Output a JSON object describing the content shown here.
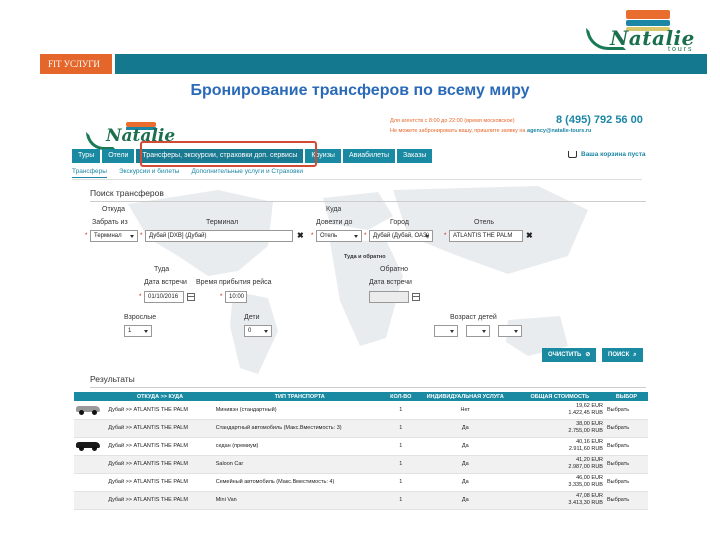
{
  "slide": {
    "fit_label": "FIT УСЛУГИ",
    "title": "Бронирование трансферов по всему миру",
    "logo_text": "Natalie",
    "logo_sub": "tours"
  },
  "site": {
    "logo_text": "Natalie",
    "hours_note": "Для агентств с 8:00 до 22:00 (время московское)",
    "phone": "8 (495) 792 56 00",
    "agency_note": "Не можете забронировать вашу, пришлите заявку на",
    "email": "agency@natalie-tours.ru",
    "cart": "Ваша корзина пуста"
  },
  "nav": {
    "items": [
      "Туры",
      "Отели",
      "Трансферы, экскурсии, страховки доп. сервисы",
      "Круизы",
      "Авиабилеты",
      "Заказы"
    ]
  },
  "subnav": {
    "items": [
      "Трансферы",
      "Экскурсии и билеты",
      "Дополнительные услуги и Страховки"
    ]
  },
  "search": {
    "title": "Поиск трансферов",
    "from_label": "Откуда",
    "to_label": "Куда",
    "pickup_label": "Забрать из",
    "pickup_value": "Терминал",
    "terminal_label": "Терминал",
    "terminal_value": "Дубай [DXB] (Дубай)",
    "dropoff_label": "Довезти до",
    "dropoff_value": "Отель",
    "city_label": "Город",
    "city_value": "Дубай (Дубай, ОАЭ)",
    "hotel_label": "Отель",
    "hotel_value": "ATLANTIS THE PALM",
    "there_back_label": "Туда и обратно",
    "there_label": "Туда",
    "back_label": "Обратно",
    "meet_date_label": "Дата встречи",
    "meet_date_value": "01/10/2016",
    "arrival_time_label": "Время прибытия рейса",
    "arrival_time_value": "10:00",
    "return_date_label": "Дата встречи",
    "return_date_value": "",
    "adults_label": "Взрослые",
    "adults_value": "1",
    "children_label": "Дети",
    "children_value": "0",
    "child_age_label": "Возраст детей",
    "clear_button": "ОЧИСТИТЬ",
    "search_button": "ПОИСК"
  },
  "results": {
    "title": "Результаты",
    "headers": [
      "",
      "ОТКУДА >> КУДА",
      "ТИП ТРАНСПОРТА",
      "КОЛ-ВО",
      "ИНДИВИДУАЛЬНАЯ УСЛУГА",
      "ОБЩАЯ СТОИМОСТЬ",
      "ВЫБОР"
    ],
    "rows": [
      {
        "route": "Дубай >> ATLANTIS THE PALM",
        "type": "Минивэн (стандартный)",
        "qty": "1",
        "individual": "Нет",
        "price_eur": "19,62 EUR",
        "price_rub": "1.422,45 RUB",
        "action": "Выбрать",
        "car_color": "#9a9a9a"
      },
      {
        "route": "Дубай >> ATLANTIS THE PALM",
        "type": "Стандартный автомобиль (Макс.Вместимость: 3)",
        "qty": "1",
        "individual": "Да",
        "price_eur": "38,00 EUR",
        "price_rub": "2.755,00 RUB",
        "action": "Выбрать",
        "car_color": ""
      },
      {
        "route": "Дубай >> ATLANTIS THE PALM",
        "type": "седан (премиум)",
        "qty": "1",
        "individual": "Да",
        "price_eur": "40,16 EUR",
        "price_rub": "2.911,60 RUB",
        "action": "Выбрать",
        "car_color": "#1a1a1a"
      },
      {
        "route": "Дубай >> ATLANTIS THE PALM",
        "type": "Saloon Car",
        "qty": "1",
        "individual": "Да",
        "price_eur": "41,20 EUR",
        "price_rub": "2.987,00 RUB",
        "action": "Выбрать",
        "car_color": ""
      },
      {
        "route": "Дубай >> ATLANTIS THE PALM",
        "type": "Семейный автомобиль (Макс.Вместимость: 4)",
        "qty": "1",
        "individual": "Да",
        "price_eur": "46,00 EUR",
        "price_rub": "3.335,00 RUB",
        "action": "Выбрать",
        "car_color": ""
      },
      {
        "route": "Дубай >> ATLANTIS THE PALM",
        "type": "Mini Van",
        "qty": "1",
        "individual": "Да",
        "price_eur": "47,08 EUR",
        "price_rub": "3.413,30 RUB",
        "action": "Выбрать",
        "car_color": ""
      }
    ]
  },
  "colors": {
    "accent_orange": "#e5662a",
    "accent_teal": "#14788e",
    "nav_blue": "#1a8aa3",
    "title_blue": "#2a6ab7",
    "highlight_red": "#d34a35"
  }
}
